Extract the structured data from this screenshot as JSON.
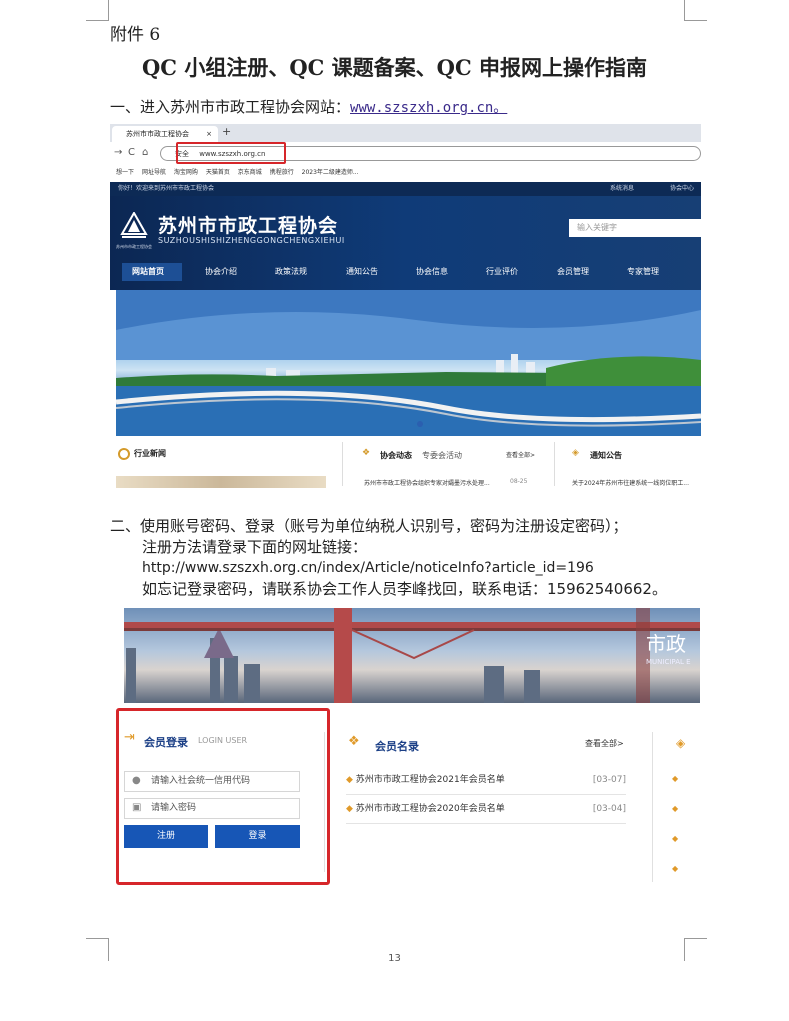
{
  "attachment_label": "附件 6",
  "doc_title": "QC 小组注册、QC 课题备案、QC 申报网上操作指南",
  "step1": {
    "text": "一、进入苏州市市政工程协会网站：",
    "link": "www.szszxh.org.cn。"
  },
  "browser": {
    "tab_title": "苏州市市政工程协会",
    "tab_close": "×",
    "new_tab": "+",
    "nav_back": "→",
    "nav_reload": "C",
    "nav_home": "⌂",
    "url_secure": "安全",
    "url": "www.szszxh.org.cn",
    "bookmarks": [
      "想一下",
      "网址导航",
      "淘宝网购",
      "天猫首页",
      "京东商城",
      "携程旅行",
      "2023年二级建造师..."
    ]
  },
  "site": {
    "welcome": "你好！欢迎来到苏州市市政工程协会",
    "sys_msg": "系统消息",
    "member_center": "协会中心",
    "name": "苏州市市政工程协会",
    "pinyin": "SUZHOUSHISHIZHENGGONGCHENGXIEHUI",
    "logo_caption": "苏州市市政工程协会",
    "search_placeholder": "输入关键字",
    "menu": [
      "网站首页",
      "协会介绍",
      "政策法规",
      "通知公告",
      "协会信息",
      "行业评价",
      "会员管理",
      "专家管理"
    ],
    "news_title": "行业新闻",
    "dynamics_title": "协会动态",
    "dynamics_sub": "专委会活动",
    "view_all": "查看全部>",
    "dynamics_item": "苏州市市政工程协会组织专家对孀墨污水处理...",
    "dynamics_date": "08-25",
    "notice_title": "通知公告",
    "notice_item": "关于2024年苏州市往建系统一线岗位职工..."
  },
  "step2": {
    "line1": "二、使用账号密码、登录（账号为单位纳税人识别号，密码为注册设定密码）；",
    "line2": "注册方法请登录下面的网址链接：",
    "line3": "http://www.szszxh.org.cn/index/Article/noticeInfo?article_id=196",
    "line4": "如忘记登录密码，请联系协会工作人员李峰找回，联系电话：15962540662。"
  },
  "login": {
    "banner_text": "市政",
    "banner_sub": "MUNICIPAL E",
    "title": "会员登录",
    "subtitle": "LOGIN USER",
    "account_placeholder": "请输入社会统一信用代码",
    "password_placeholder": "请输入密码",
    "register_label": "注册",
    "login_label": "登录",
    "list_title": "会员名录",
    "view_all": "查看全部>",
    "rows": [
      {
        "title": "苏州市市政工程协会2021年会员名单",
        "date": "[03-07]"
      },
      {
        "title": "苏州市市政工程协会2020年会员名单",
        "date": "[03-04]"
      }
    ]
  },
  "page_number": "13",
  "colors": {
    "accent_red": "#d6262a",
    "site_navy": "#0d2a55",
    "button_blue": "#1756b6",
    "link_purple": "#3a2a8a"
  }
}
